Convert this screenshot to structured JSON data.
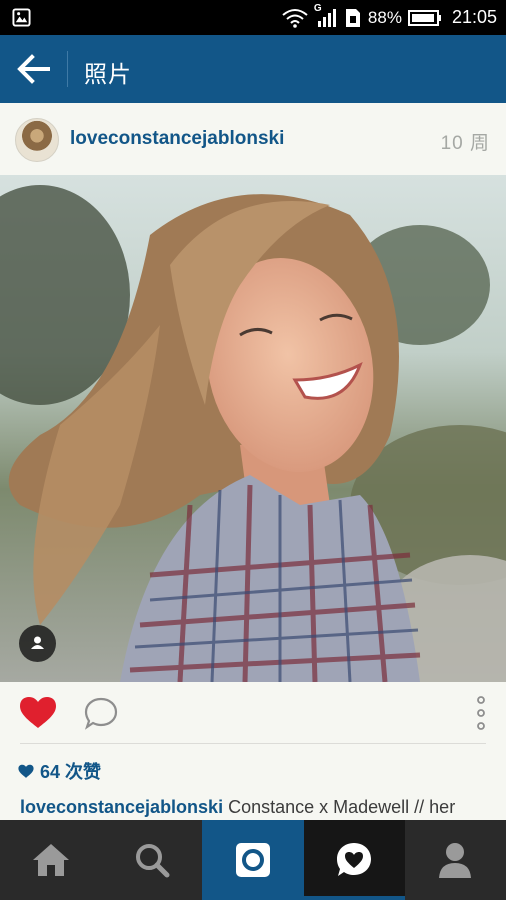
{
  "status_bar": {
    "network": "G",
    "battery": "88%",
    "time": "21:05"
  },
  "appbar": {
    "title": "照片"
  },
  "post": {
    "username": "loveconstancejablonski",
    "time_ago": "10 周",
    "likes": "64 次赞",
    "caption_user": "loveconstancejablonski",
    "caption_text": " Constance x Madewell // her"
  },
  "colors": {
    "brand": "#125688",
    "heart": "#ed4956",
    "nav_bg": "#2a2a2a"
  },
  "bottom_nav": {
    "items": [
      "home-icon",
      "search-icon",
      "camera-icon",
      "activity-icon",
      "profile-icon"
    ]
  }
}
